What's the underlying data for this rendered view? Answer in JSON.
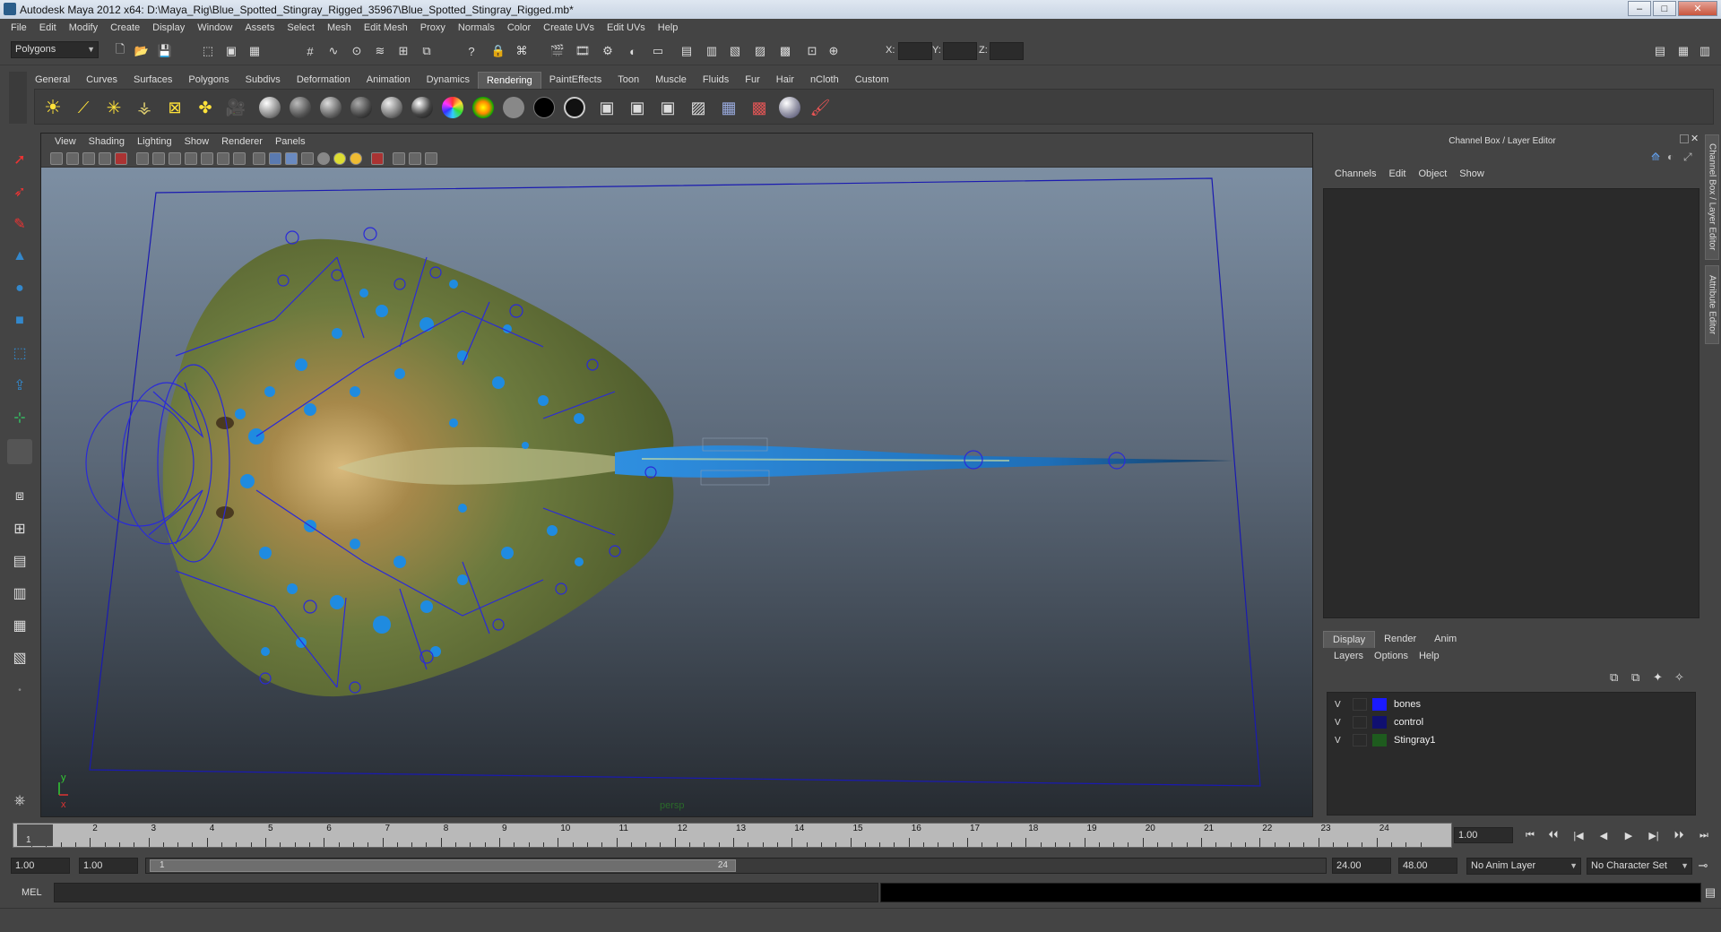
{
  "window": {
    "title": "Autodesk Maya 2012 x64: D:\\Maya_Rig\\Blue_Spotted_Stingray_Rigged_35967\\Blue_Spotted_Stingray_Rigged.mb*",
    "minimize": "–",
    "maximize": "□",
    "close": "✕"
  },
  "menubar": [
    "File",
    "Edit",
    "Modify",
    "Create",
    "Display",
    "Window",
    "Assets",
    "Select",
    "Mesh",
    "Edit Mesh",
    "Proxy",
    "Normals",
    "Color",
    "Create UVs",
    "Edit UVs",
    "Help"
  ],
  "statusline": {
    "mode": "Polygons",
    "x_label": "X:",
    "y_label": "Y:",
    "z_label": "Z:"
  },
  "shelf": {
    "tabs": [
      "General",
      "Curves",
      "Surfaces",
      "Polygons",
      "Subdivs",
      "Deformation",
      "Animation",
      "Dynamics",
      "Rendering",
      "PaintEffects",
      "Toon",
      "Muscle",
      "Fluids",
      "Fur",
      "Hair",
      "nCloth",
      "Custom"
    ],
    "active_tab": "Rendering"
  },
  "viewport": {
    "menu": [
      "View",
      "Shading",
      "Lighting",
      "Show",
      "Renderer",
      "Panels"
    ],
    "camera_label": "persp",
    "axis_y": "y",
    "axis_x": "x"
  },
  "channel_box": {
    "title": "Channel Box / Layer Editor",
    "menu": [
      "Channels",
      "Edit",
      "Object",
      "Show"
    ]
  },
  "side_tabs": [
    "Channel Box / Layer Editor",
    "Attribute Editor"
  ],
  "layer_editor": {
    "tabs": [
      "Display",
      "Render",
      "Anim"
    ],
    "active_tab": "Display",
    "menu": [
      "Layers",
      "Options",
      "Help"
    ],
    "layers": [
      {
        "visible": "V",
        "name": "bones",
        "color": "#1a1aff"
      },
      {
        "visible": "V",
        "name": "control",
        "color": "#101070"
      },
      {
        "visible": "V",
        "name": "Stingray1",
        "color": "#1e5b1e"
      }
    ]
  },
  "timeline": {
    "ticks": [
      "1",
      "2",
      "3",
      "4",
      "5",
      "6",
      "7",
      "8",
      "9",
      "10",
      "11",
      "12",
      "13",
      "14",
      "15",
      "16",
      "17",
      "18",
      "19",
      "20",
      "21",
      "22",
      "23",
      "24"
    ],
    "current_frame": "1",
    "current_time_field": "1.00",
    "playback": [
      "⏮",
      "⏴⏴",
      "|◀",
      "◀",
      "▶",
      "▶|",
      "⏵⏵",
      "⏭"
    ]
  },
  "range": {
    "start_time": "1.00",
    "playback_start": "1.00",
    "handle_start": "1",
    "handle_end": "24",
    "playback_end": "24.00",
    "end_time": "48.00",
    "anim_layer": "No Anim Layer",
    "character_set": "No Character Set"
  },
  "command_line": {
    "label": "MEL"
  },
  "colors": {
    "ui_bg": "#444444",
    "field_bg": "#2b2b2b",
    "rig_blue": "#2a2ad8",
    "ray_body": "#6b7a3a",
    "ray_spots": "#1f8be0"
  }
}
